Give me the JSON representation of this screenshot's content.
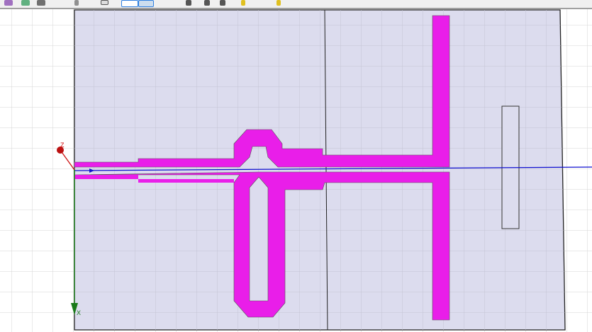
{
  "toolbar": {
    "icons": [
      "select-icon",
      "pan-icon",
      "rotate-icon",
      "zoom-icon",
      "fit-icon",
      "grid-snap-icon",
      "line-style-icon",
      "draw-box-icon",
      "draw-cylinder-icon",
      "draw-sphere-icon",
      "boolean-icon",
      "measure-icon"
    ]
  },
  "viewport": {
    "axes": {
      "z_label": "Z",
      "x_label": "X"
    },
    "colors": {
      "substrate": "#dcdcee",
      "trace": "#e91ee9",
      "x_axis": "#1a7a1a",
      "z_axis": "#cc1111",
      "y_axis": "#1010d0"
    }
  }
}
